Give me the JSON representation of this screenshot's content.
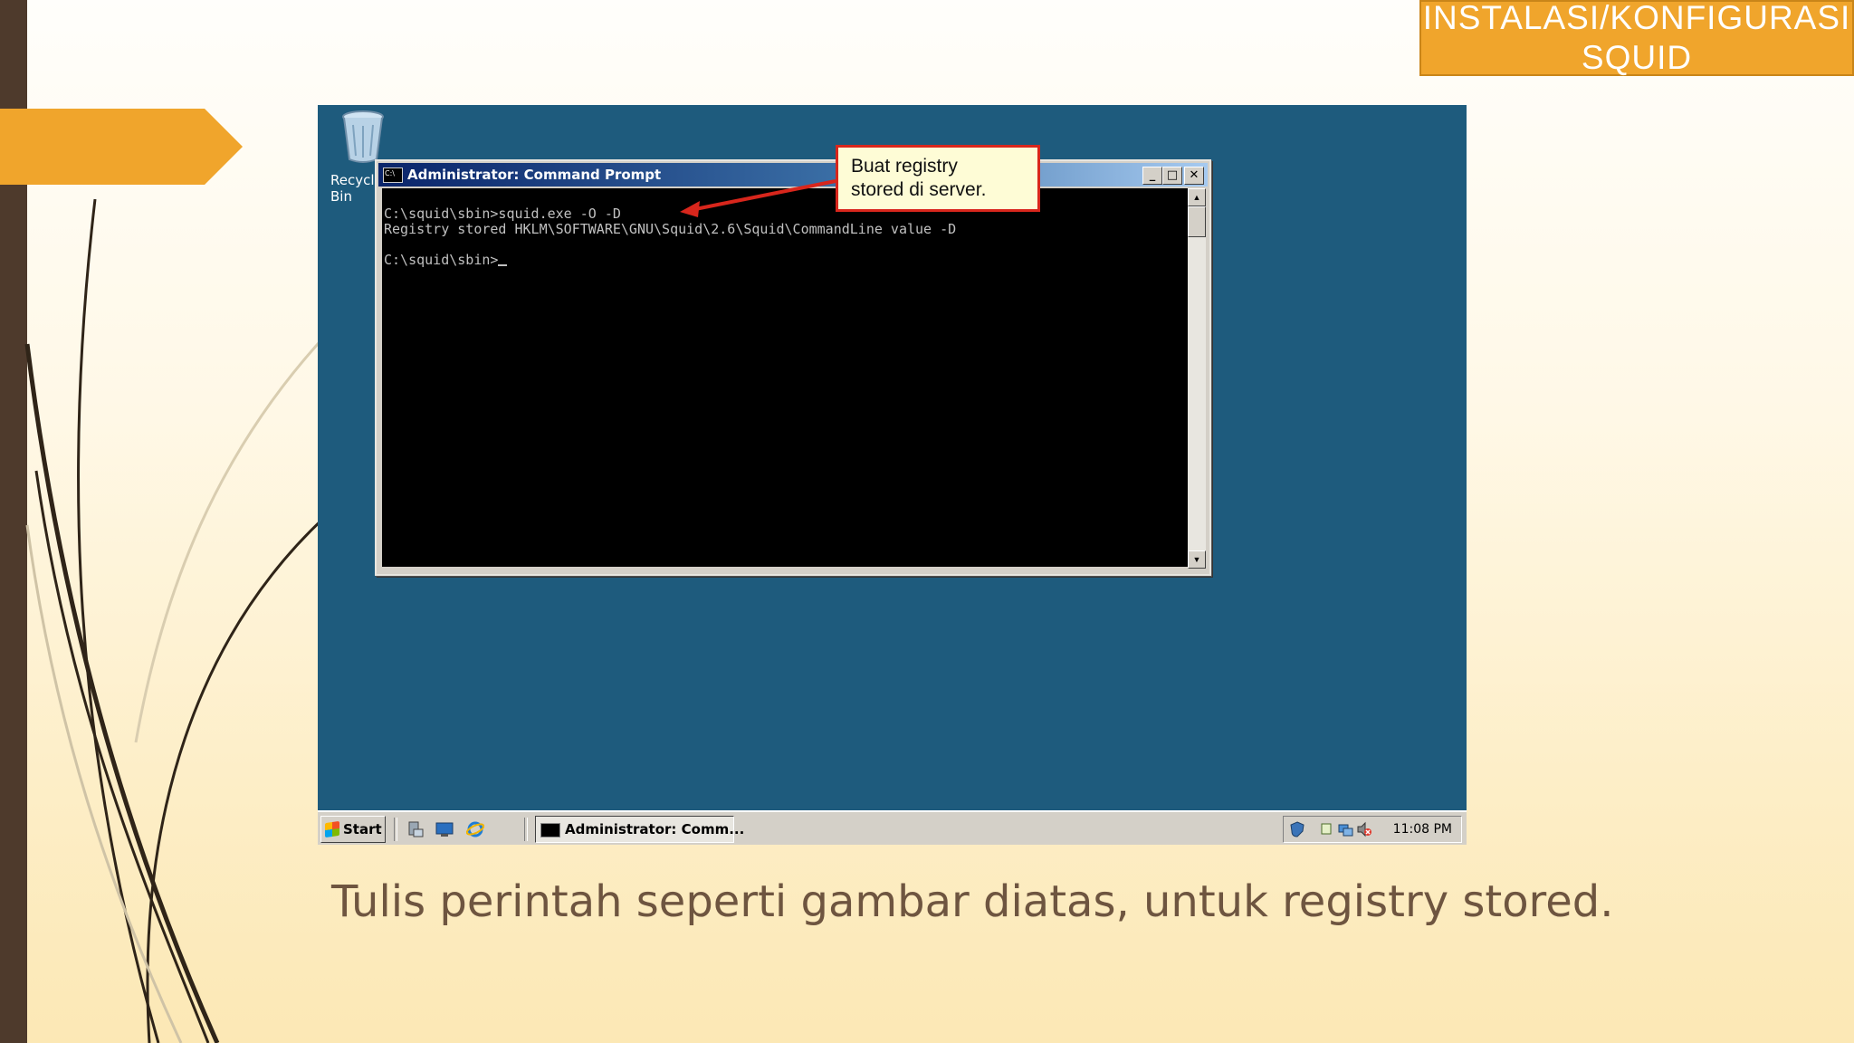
{
  "slide": {
    "title": "INSTALASI/KONFIGURASI SQUID",
    "caption": "Tulis perintah seperti gambar diatas, untuk registry stored.",
    "colors": {
      "accent": "#f0a52c",
      "left_bar": "#4e3a2c",
      "caption_text": "#6e5540",
      "desktop": "#1e5b7d"
    }
  },
  "desktop": {
    "recycle_bin_label": "Recycle Bin"
  },
  "cmd_window": {
    "title": "Administrator: Command Prompt",
    "buttons": {
      "minimize": "_",
      "maximize": "□",
      "close": "✕"
    },
    "lines": [
      "C:\\squid\\sbin>squid.exe -O -D",
      "Registry stored HKLM\\SOFTWARE\\GNU\\Squid\\2.6\\Squid\\CommandLine value -D",
      "",
      "C:\\squid\\sbin>"
    ]
  },
  "callout": {
    "text_line1": "Buat registry",
    "text_line2": "stored di server.",
    "border_color": "#d8261c"
  },
  "taskbar": {
    "start_label": "Start",
    "task_label": "Administrator: Comm...",
    "clock": "11:08 PM",
    "quick_launch_icons": [
      "server-manager-icon",
      "computer-icon",
      "internet-explorer-icon"
    ],
    "tray_icons": [
      "network-icon",
      "display-icon",
      "volume-muted-icon",
      "security-icon"
    ]
  }
}
